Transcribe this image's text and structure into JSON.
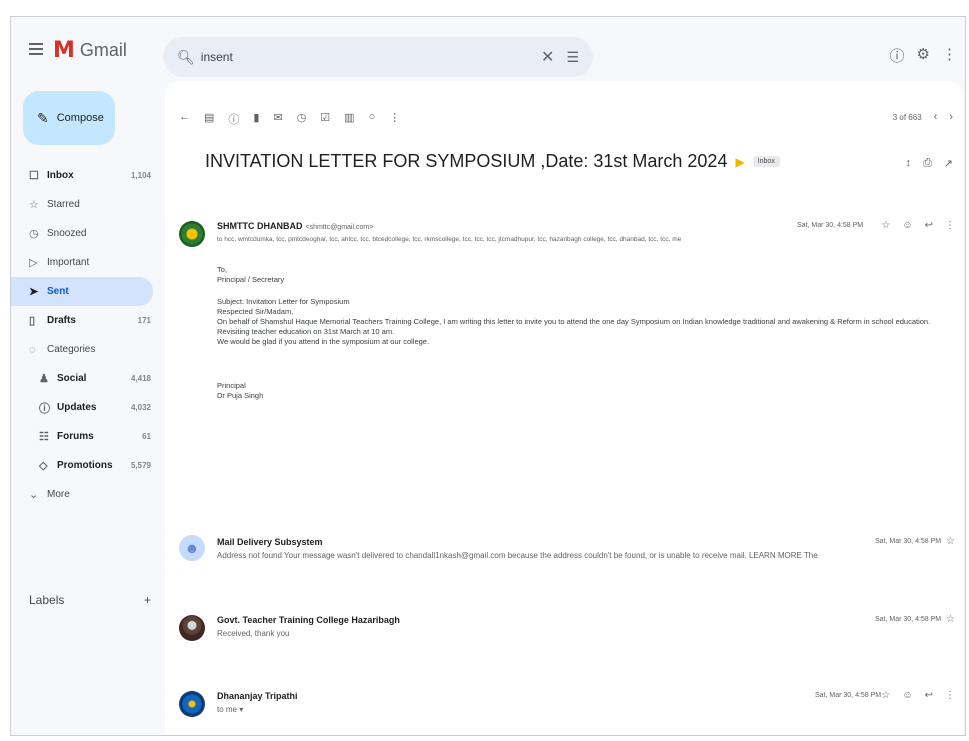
{
  "app": {
    "name": "Gmail"
  },
  "search": {
    "value": "insent"
  },
  "sidebar": {
    "compose_label": "Compose",
    "items": [
      {
        "label": "Inbox",
        "count": "1,104",
        "icon": "inbox-icon"
      },
      {
        "label": "Starred",
        "count": "",
        "icon": "star-icon"
      },
      {
        "label": "Snoozed",
        "count": "",
        "icon": "clock-icon"
      },
      {
        "label": "Important",
        "count": "",
        "icon": "important-icon"
      },
      {
        "label": "Sent",
        "count": "",
        "icon": "send-icon"
      },
      {
        "label": "Drafts",
        "count": "171",
        "icon": "draft-icon"
      },
      {
        "label": "Categories",
        "count": "",
        "icon": "categories-icon"
      },
      {
        "label": "Social",
        "count": "4,418",
        "icon": "social-icon"
      },
      {
        "label": "Updates",
        "count": "4,032",
        "icon": "updates-icon"
      },
      {
        "label": "Forums",
        "count": "61",
        "icon": "forums-icon"
      },
      {
        "label": "Promotions",
        "count": "5,579",
        "icon": "promotions-icon"
      },
      {
        "label": "More",
        "count": "",
        "icon": "chevron-down-icon"
      }
    ],
    "labels_heading": "Labels",
    "labels_add": "+"
  },
  "toolbar": {
    "pagination": "3 of 663"
  },
  "thread": {
    "subject": "INVITATION LETTER FOR SYMPOSIUM ,Date: 31st March 2024",
    "tag": "Inbox"
  },
  "messages": [
    {
      "sender": "SHMTTC DHANBAD",
      "email": "<shmttc@gmail.com>",
      "recipients": "to hcc, wmtcdumka, tcc, pmtcdeoghar, tcc, ahtcc, tcc, btcedcollege, tcc, rkmscollege, tcc, tcc, tcc, jtcmadhupur, tcc, hazaribagh college, tcc, dhanbad, tcc, tcc, me",
      "date": "Sat, Mar 30, 4:58 PM",
      "body": [
        "To,",
        "Principal / Secretary",
        "",
        "Subject: Invitation Letter for Symposium",
        "Respected Sir/Madam,",
        "On behalf of Shamshul Haque Memorial Teachers Training College, I am writing this letter to invite you to attend the one day Symposium on Indian knowledge traditional and awakening & Reform in school education.",
        "Revisiting teacher education on 31st March at 10 am.",
        "We would be glad if you attend in the symposium at our college.",
        "",
        "",
        "Principal",
        "Dr Puja Singh"
      ]
    },
    {
      "sender": "Mail Delivery Subsystem",
      "snippet": "Address not found Your message wasn't delivered to chandall1nkash@gmail.com because the address couldn't be found, or is unable to receive mail. LEARN MORE The",
      "date": "Sat, Mar 30, 4:58 PM"
    },
    {
      "sender": "Govt. Teacher Training College Hazaribagh",
      "snippet": "Received, thank you",
      "date": "Sat, Mar 30, 4:58 PM"
    },
    {
      "sender": "Dhananjay Tripathi",
      "snippet": "to me ▾",
      "date": "Sat, Mar 30, 4:58 PM"
    }
  ],
  "colors": {
    "compose_bg": "#c2e7ff",
    "active_nav_bg": "#d3e3fd",
    "accent": "#0b57d0",
    "gmail_red": "#d93025",
    "important": "#f2b600"
  }
}
